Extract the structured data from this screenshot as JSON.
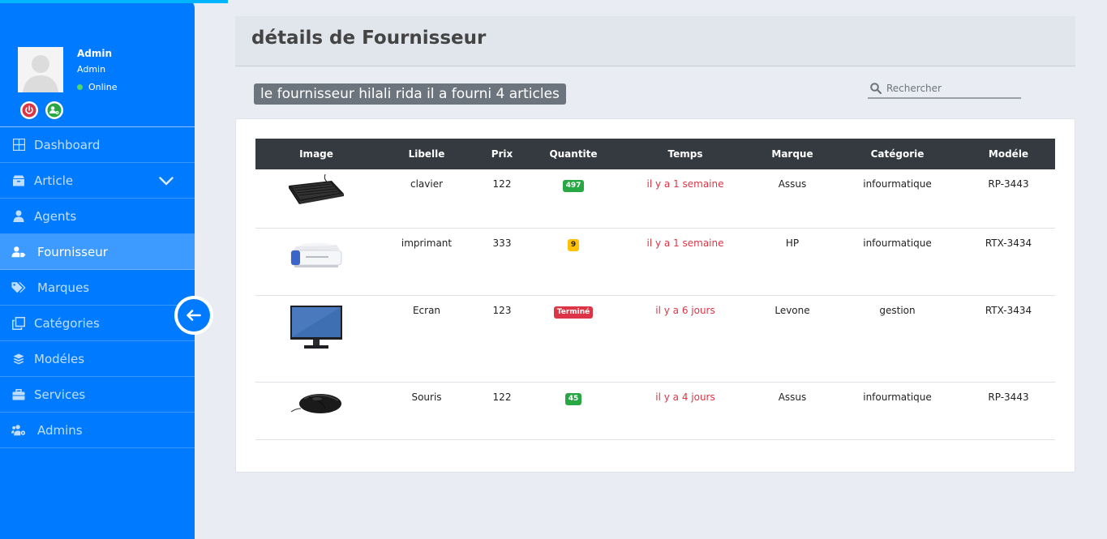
{
  "sidebar": {
    "user": {
      "name": "Admin",
      "role": "Admin",
      "status": "Online"
    },
    "items": [
      {
        "label": "Dashboard",
        "icon": "dashboard-icon"
      },
      {
        "label": "Article",
        "icon": "box-icon"
      },
      {
        "label": "Agents",
        "icon": "user-icon"
      },
      {
        "label": "Fournisseur",
        "icon": "user-tag-icon"
      },
      {
        "label": "Marques",
        "icon": "tags-icon"
      },
      {
        "label": "Catégories",
        "icon": "clone-icon"
      },
      {
        "label": "Modéles",
        "icon": "layers-icon"
      },
      {
        "label": "Services",
        "icon": "briefcase-icon"
      },
      {
        "label": "Admins",
        "icon": "users-cog-icon"
      }
    ]
  },
  "page": {
    "title": "détails de Fournisseur",
    "supplier_summary": "le fournisseur hilali rida il a fourni 4 articles",
    "search_placeholder": "Rechercher"
  },
  "table": {
    "headers": [
      "Image",
      "Libelle",
      "Prix",
      "Quantite",
      "Temps",
      "Marque",
      "Catégorie",
      "Modéle"
    ],
    "rows": [
      {
        "image": "keyboard",
        "libelle": "clavier",
        "prix": "122",
        "quantite": "497",
        "quantite_color": "green",
        "temps": "il y a 1 semaine",
        "marque": "Assus",
        "categorie": "infourmatique",
        "modele": "RP-3443"
      },
      {
        "image": "printer",
        "libelle": "imprimant",
        "prix": "333",
        "quantite": "9",
        "quantite_color": "yellow",
        "temps": "il y a 1 semaine",
        "marque": "HP",
        "categorie": "infourmatique",
        "modele": "RTX-3434"
      },
      {
        "image": "monitor",
        "libelle": "Ecran",
        "prix": "123",
        "quantite": "Terminé",
        "quantite_color": "red",
        "temps": "il y a 6 jours",
        "marque": "Levone",
        "categorie": "gestion",
        "modele": "RTX-3434"
      },
      {
        "image": "mouse",
        "libelle": "Souris",
        "prix": "122",
        "quantite": "45",
        "quantite_color": "green",
        "temps": "il y a 4 jours",
        "marque": "Assus",
        "categorie": "infourmatique",
        "modele": "RP-3443"
      }
    ]
  },
  "colors": {
    "sidebar": "#007bff",
    "active": "#3d9bff",
    "danger": "#dc3545",
    "success": "#28a745",
    "warning": "#ffc107",
    "table_head": "#343a40"
  }
}
